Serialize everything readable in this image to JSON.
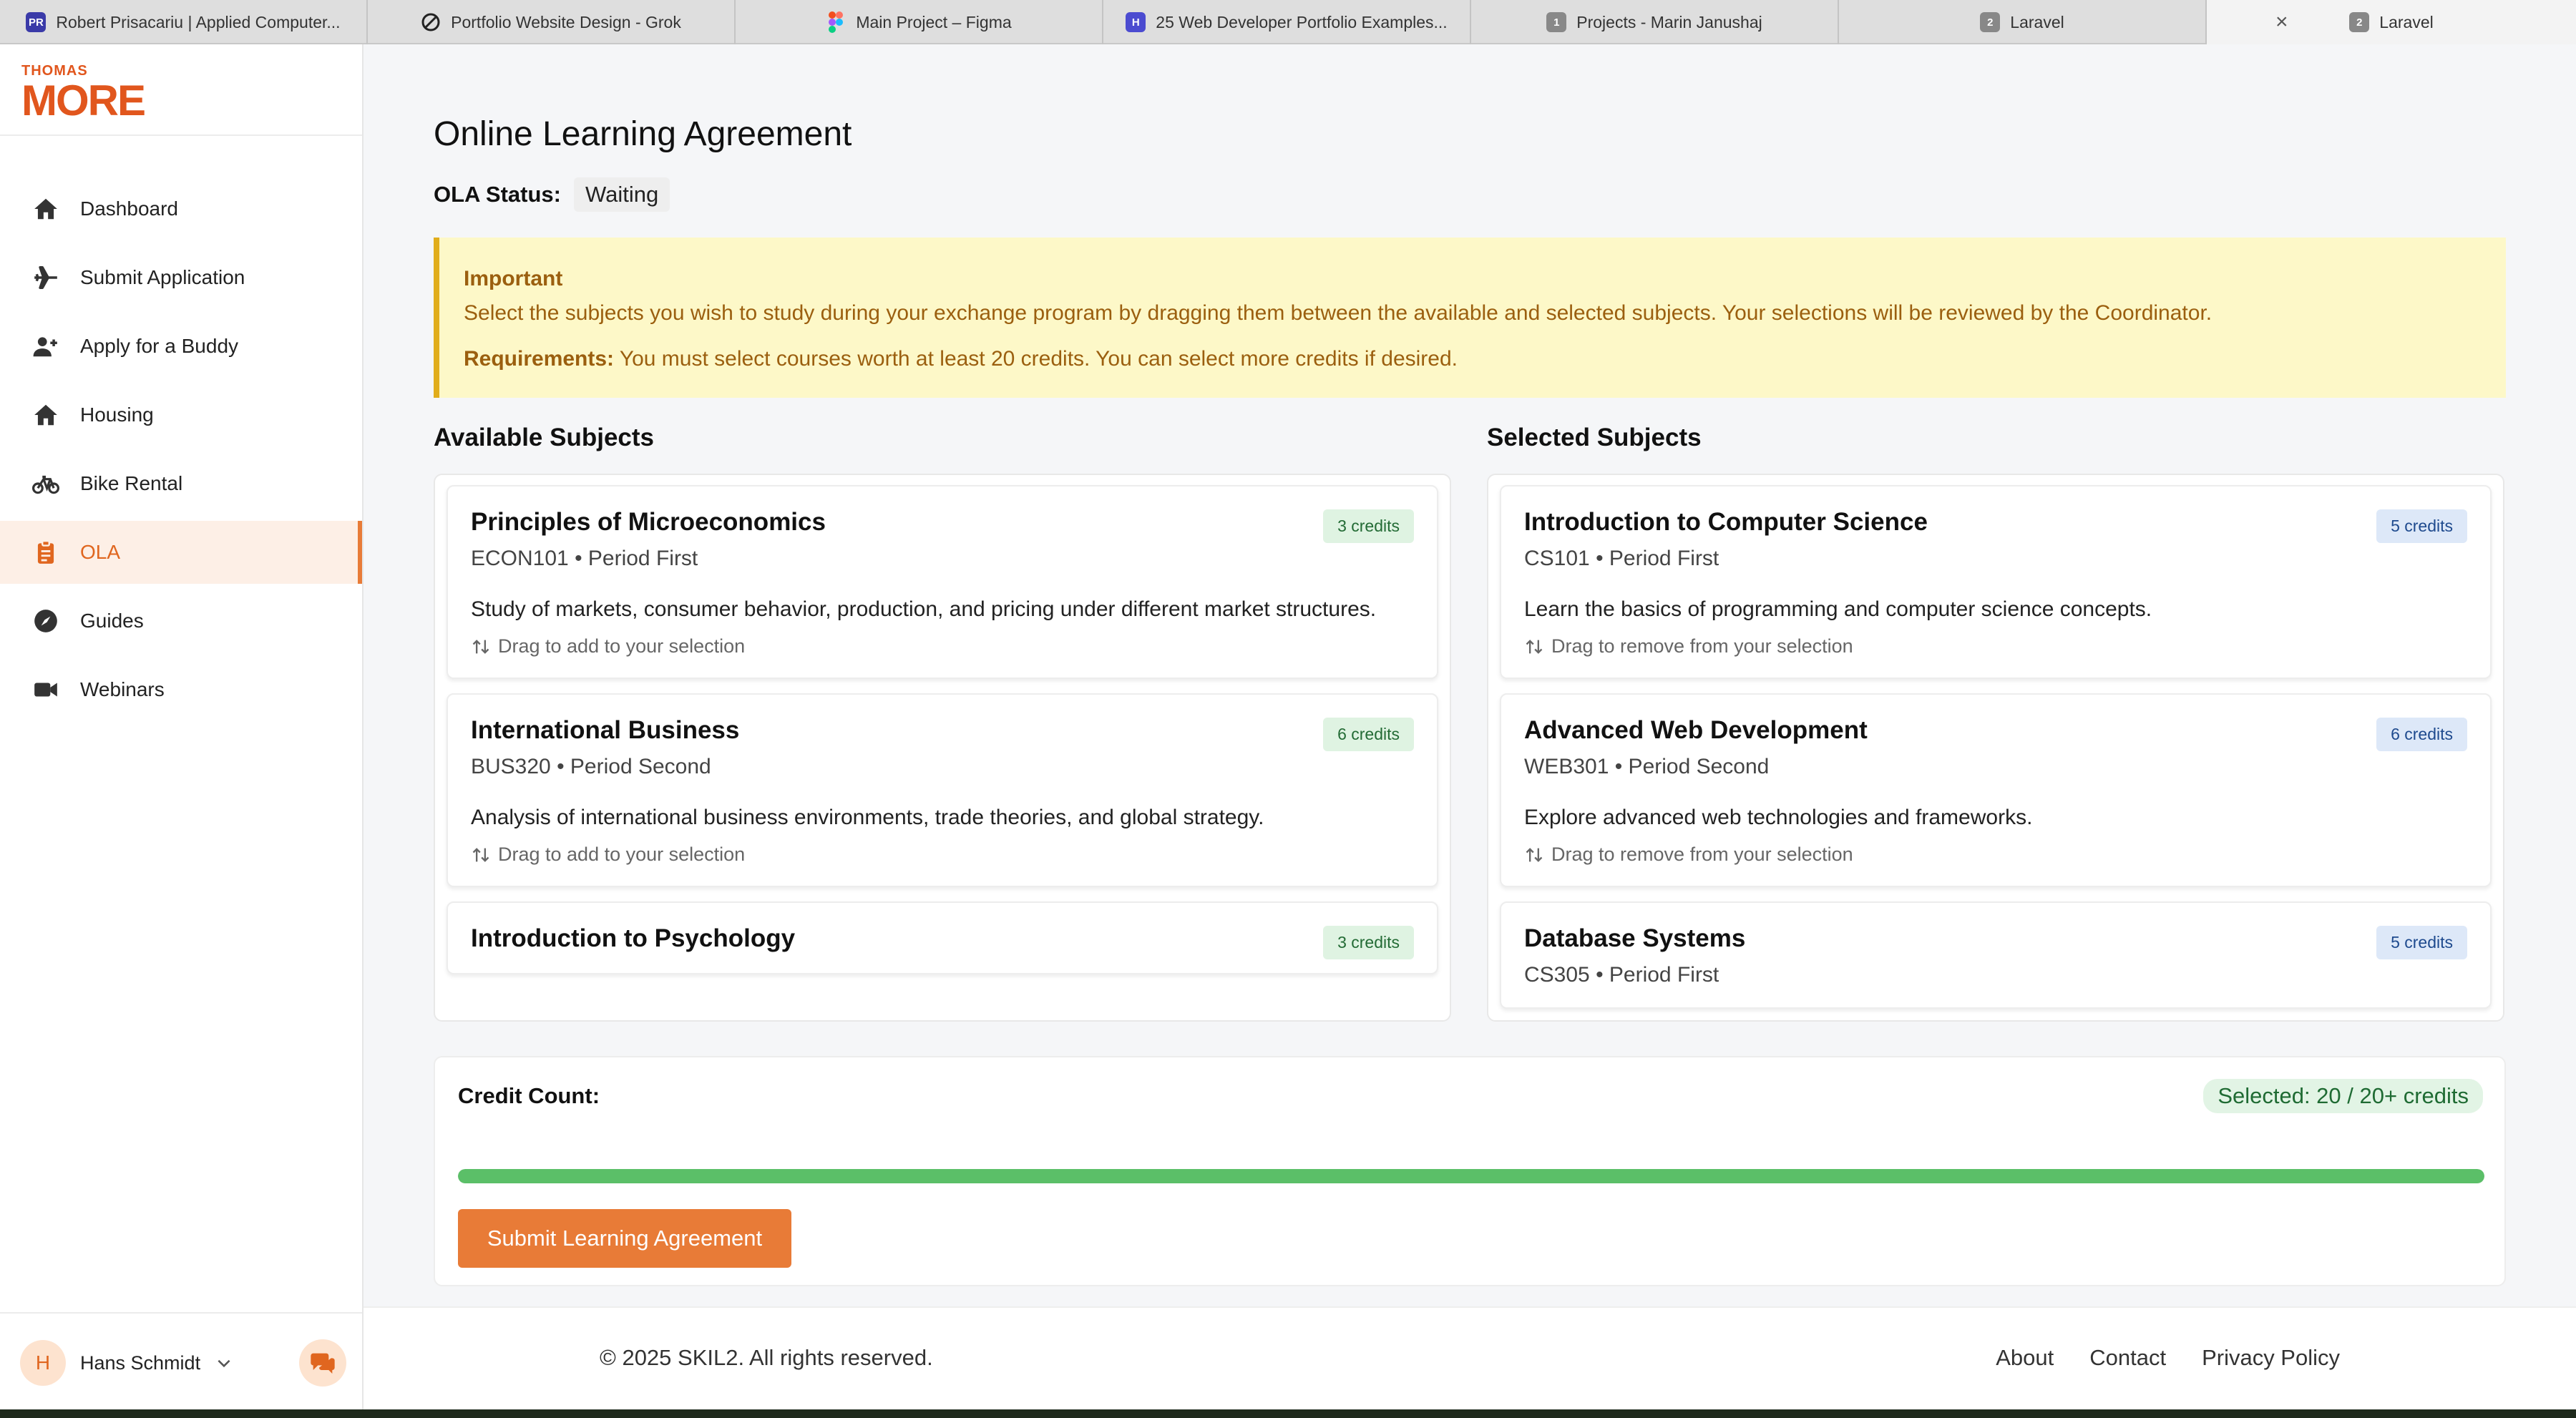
{
  "browser": {
    "tabs": [
      {
        "title": "Robert Prisacariu | Applied Computer...",
        "icon": "pr-favicon",
        "favicon_text": "PR",
        "color": "#3a3aa8"
      },
      {
        "title": "Portfolio Website Design - Grok",
        "icon": "grok-favicon",
        "favicon_text": "",
        "color": "#222222"
      },
      {
        "title": "Main Project – Figma",
        "icon": "figma-favicon",
        "favicon_text": "",
        "color": "#e4572e"
      },
      {
        "title": "25 Web Developer Portfolio Examples...",
        "icon": "h-favicon",
        "favicon_text": "H",
        "color": "#4b4bd0"
      },
      {
        "title": "Projects - Marin Janushaj",
        "icon": "badge-favicon",
        "favicon_text": "1",
        "color": "#888888"
      },
      {
        "title": "Laravel",
        "icon": "badge-favicon",
        "favicon_text": "2",
        "color": "#888888"
      },
      {
        "title": "Laravel",
        "icon": "badge-favicon",
        "favicon_text": "2",
        "color": "#888888"
      }
    ]
  },
  "sidebar": {
    "logo_top": "THOMAS",
    "logo_bottom": "MORE",
    "items": [
      {
        "label": "Dashboard",
        "icon": "home-icon"
      },
      {
        "label": "Submit Application",
        "icon": "plane-icon"
      },
      {
        "label": "Apply for a Buddy",
        "icon": "user-plus-icon"
      },
      {
        "label": "Housing",
        "icon": "home-icon"
      },
      {
        "label": "Bike Rental",
        "icon": "bike-icon"
      },
      {
        "label": "OLA",
        "icon": "clipboard-icon",
        "active": true
      },
      {
        "label": "Guides",
        "icon": "compass-icon"
      },
      {
        "label": "Webinars",
        "icon": "video-icon"
      }
    ],
    "user": {
      "initial": "H",
      "name": "Hans Schmidt"
    }
  },
  "main": {
    "title": "Online Learning Agreement",
    "status_label": "OLA Status:",
    "status_value": "Waiting",
    "alert": {
      "title": "Important",
      "text": "Select the subjects you wish to study during your exchange program by dragging them between the available and selected subjects. Your selections will be reviewed by the Coordinator.",
      "req_label": "Requirements:",
      "req_text": " You must select courses worth at least 20 credits. You can select more credits if desired."
    },
    "available_title": "Available Subjects",
    "selected_title": "Selected Subjects",
    "available": [
      {
        "name": "Principles of Microeconomics",
        "meta": "ECON101 • Period First",
        "desc": "Study of markets, consumer behavior, production, and pricing under different market structures.",
        "hint": "Drag to add to your selection",
        "credits": "3 credits"
      },
      {
        "name": "International Business",
        "meta": "BUS320 • Period Second",
        "desc": "Analysis of international business environments, trade theories, and global strategy.",
        "hint": "Drag to add to your selection",
        "credits": "6 credits"
      },
      {
        "name": "Introduction to Psychology",
        "meta": "",
        "desc": "",
        "hint": "",
        "credits": "3 credits"
      }
    ],
    "selected": [
      {
        "name": "Introduction to Computer Science",
        "meta": "CS101 • Period First",
        "desc": "Learn the basics of programming and computer science concepts.",
        "hint": "Drag to remove from your selection",
        "credits": "5 credits"
      },
      {
        "name": "Advanced Web Development",
        "meta": "WEB301 • Period Second",
        "desc": "Explore advanced web technologies and frameworks.",
        "hint": "Drag to remove from your selection",
        "credits": "6 credits"
      },
      {
        "name": "Database Systems",
        "meta": "CS305 • Period First",
        "desc": "",
        "hint": "",
        "credits": "5 credits"
      }
    ],
    "credit_label": "Credit Count:",
    "credit_selected": "Selected: 20 / 20+ credits",
    "progress_fraction": 1.0,
    "submit_label": "Submit Learning Agreement"
  },
  "footer": {
    "copyright": "© 2025 SKIL2. All rights reserved.",
    "links": [
      "About",
      "Contact",
      "Privacy Policy"
    ]
  },
  "colors": {
    "accent": "#e87b37",
    "brand": "#e1561d",
    "progress": "#5bbf68"
  }
}
